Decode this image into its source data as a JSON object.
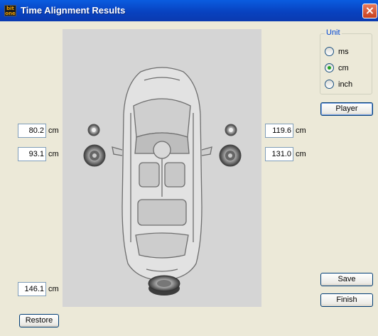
{
  "window": {
    "title": "Time Alignment Results",
    "icon": "app-logo-icon",
    "close_glyph": "×"
  },
  "fields": {
    "left_tweeter": "80.2",
    "left_woofer": "93.1",
    "right_tweeter": "119.6",
    "right_woofer": "131.0",
    "subwoofer": "146.1"
  },
  "units": {
    "left_tweeter": "cm",
    "left_woofer": "cm",
    "right_tweeter": "cm",
    "right_woofer": "cm",
    "subwoofer": "cm"
  },
  "unit_group": {
    "label": "Unit",
    "options": [
      "ms",
      "cm",
      "inch"
    ],
    "selected": "cm"
  },
  "buttons": {
    "player": "Player",
    "save": "Save",
    "finish": "Finish",
    "restore": "Restore"
  },
  "colors": {
    "titlebar": "#0a4fd8",
    "close": "#d9512c",
    "panel": "#d5d5d5",
    "radio_dot": "#21a121",
    "group_label": "#0046d5"
  }
}
